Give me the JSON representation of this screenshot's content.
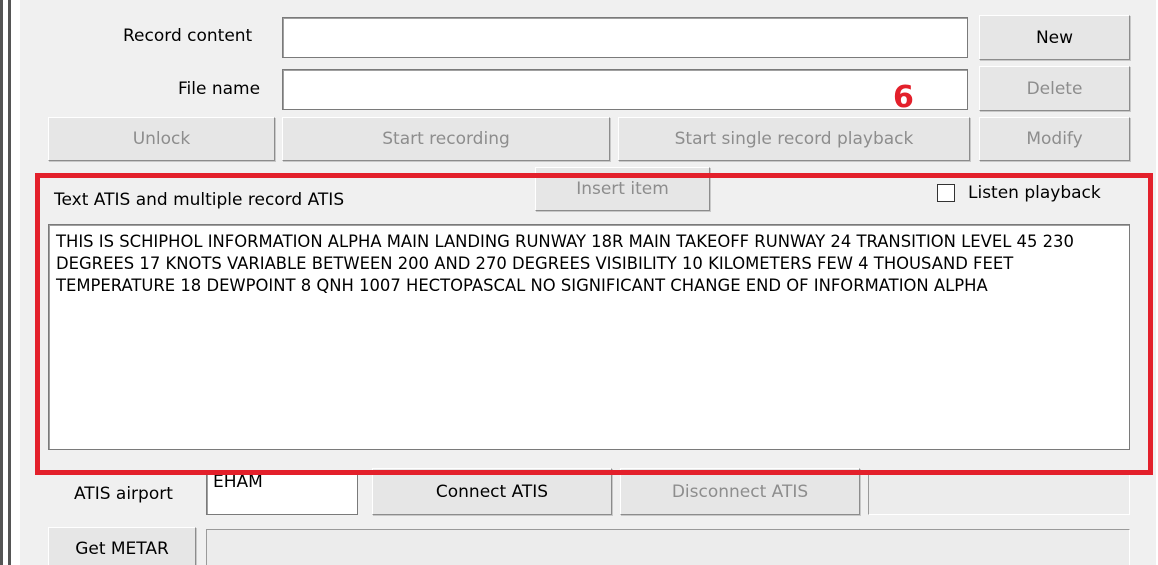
{
  "form": {
    "record_content_label": "Record content",
    "record_content_value": "",
    "file_name_label": "File name",
    "file_name_value": "",
    "new_button": "New",
    "delete_button": "Delete",
    "unlock_button": "Unlock",
    "start_recording_button": "Start recording",
    "start_single_playback_button": "Start single record playback",
    "modify_button": "Modify"
  },
  "annotation": {
    "number": "6",
    "color": "#e3202b"
  },
  "atis_section": {
    "title": "Text ATIS and multiple record ATIS",
    "insert_item_button": "Insert item",
    "listen_playback_label": "Listen playback",
    "listen_playback_checked": false,
    "text": "THIS IS SCHIPHOL INFORMATION ALPHA MAIN LANDING RUNWAY 18R MAIN TAKEOFF RUNWAY 24 TRANSITION LEVEL 45 230 DEGREES 17 KNOTS VARIABLE BETWEEN 200 AND 270 DEGREES VISIBILITY 10 KILOMETERS FEW 4 THOUSAND FEET TEMPERATURE 18 DEWPOINT 8 QNH 1007 HECTOPASCAL NO SIGNIFICANT CHANGE END OF INFORMATION ALPHA"
  },
  "bottom": {
    "atis_airport_label": "ATIS airport",
    "atis_airport_value": "EHAM",
    "connect_atis_button": "Connect ATIS",
    "disconnect_atis_button": "Disconnect ATIS",
    "status_value": "",
    "get_metar_button": "Get METAR",
    "metar_value": ""
  }
}
